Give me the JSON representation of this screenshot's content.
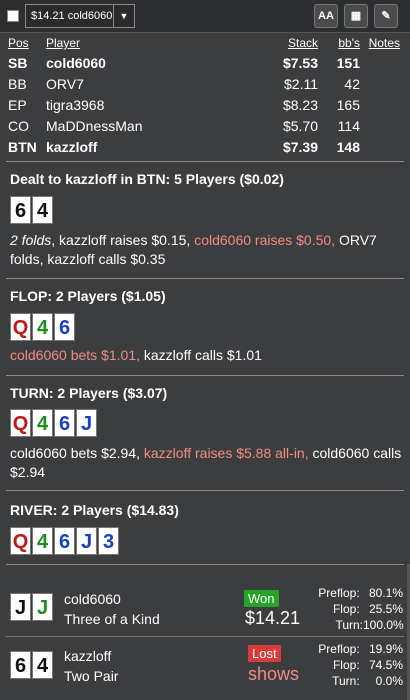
{
  "toolbar": {
    "selected_hand": "$14.21 cold6060",
    "font_button": "AA",
    "grid_button": "▦",
    "edit_button": "✎"
  },
  "players": {
    "headers": {
      "pos": "Pos",
      "player": "Player",
      "stack": "Stack",
      "bbs": "bb's",
      "notes": "Notes"
    },
    "rows": [
      {
        "pos": "SB",
        "player": "cold6060",
        "stack": "$7.53",
        "bbs": "151",
        "bold": true
      },
      {
        "pos": "BB",
        "player": "ORV7",
        "stack": "$2.11",
        "bbs": "42",
        "bold": false
      },
      {
        "pos": "EP",
        "player": "tigra3968",
        "stack": "$8.23",
        "bbs": "165",
        "bold": false
      },
      {
        "pos": "CO",
        "player": "MaDDnessMan",
        "stack": "$5.70",
        "bbs": "114",
        "bold": false
      },
      {
        "pos": "BTN",
        "player": "kazzloff",
        "stack": "$7.39",
        "bbs": "148",
        "bold": true
      }
    ]
  },
  "preflop": {
    "header": "Dealt to kazzloff in BTN: 5 Players ($0.02)",
    "cards": [
      {
        "rank": "6",
        "suit": "s"
      },
      {
        "rank": "4",
        "suit": "s"
      }
    ],
    "actions": {
      "a1": "2 folds",
      "a2": ", kazzloff raises $0.15, ",
      "a3": "cold6060 raises $0.50,",
      "a4": " ORV7 folds, kazzloff calls $0.35"
    }
  },
  "flop": {
    "header": "FLOP: 2 Players ($1.05)",
    "cards": [
      {
        "rank": "Q",
        "suit": "h"
      },
      {
        "rank": "4",
        "suit": "c"
      },
      {
        "rank": "6",
        "suit": "d"
      }
    ],
    "actions": {
      "a1": "cold6060 bets $1.01,",
      "a2": " kazzloff calls $1.01"
    }
  },
  "turn": {
    "header": "TURN: 2 Players ($3.07)",
    "cards": [
      {
        "rank": "Q",
        "suit": "h"
      },
      {
        "rank": "4",
        "suit": "c"
      },
      {
        "rank": "6",
        "suit": "d"
      },
      {
        "rank": "J",
        "suit": "d"
      }
    ],
    "actions": {
      "a1": "cold6060 bets $2.94, ",
      "a2": "kazzloff raises $5.88 all-in,",
      "a3": " cold6060 calls $2.94"
    }
  },
  "river": {
    "header": "RIVER: 2 Players ($14.83)",
    "cards": [
      {
        "rank": "Q",
        "suit": "h"
      },
      {
        "rank": "4",
        "suit": "c"
      },
      {
        "rank": "6",
        "suit": "d"
      },
      {
        "rank": "J",
        "suit": "d"
      },
      {
        "rank": "3",
        "suit": "d"
      }
    ]
  },
  "showdown": [
    {
      "cards": [
        {
          "rank": "J",
          "suit": "s"
        },
        {
          "rank": "J",
          "suit": "c"
        }
      ],
      "name": "cold6060",
      "hand": "Three of a Kind",
      "result": "Won",
      "amount": "$14.21",
      "stats": {
        "preflop_label": "Preflop:",
        "preflop": "80.1%",
        "flop_label": "Flop:",
        "flop": "25.5%",
        "turn_label": "Turn:",
        "turn": "100.0%"
      }
    },
    {
      "cards": [
        {
          "rank": "6",
          "suit": "s"
        },
        {
          "rank": "4",
          "suit": "s"
        }
      ],
      "name": "kazzloff",
      "hand": "Two Pair",
      "result": "Lost",
      "amount": "shows",
      "stats": {
        "preflop_label": "Preflop:",
        "preflop": "19.9%",
        "flop_label": "Flop:",
        "flop": "74.5%",
        "turn_label": "Turn:",
        "turn": "0.0%"
      }
    }
  ],
  "colors": {
    "background": "#3c3d3f",
    "action_highlight": "#f28c82",
    "won": "#27a327",
    "lost": "#d93b3b"
  }
}
